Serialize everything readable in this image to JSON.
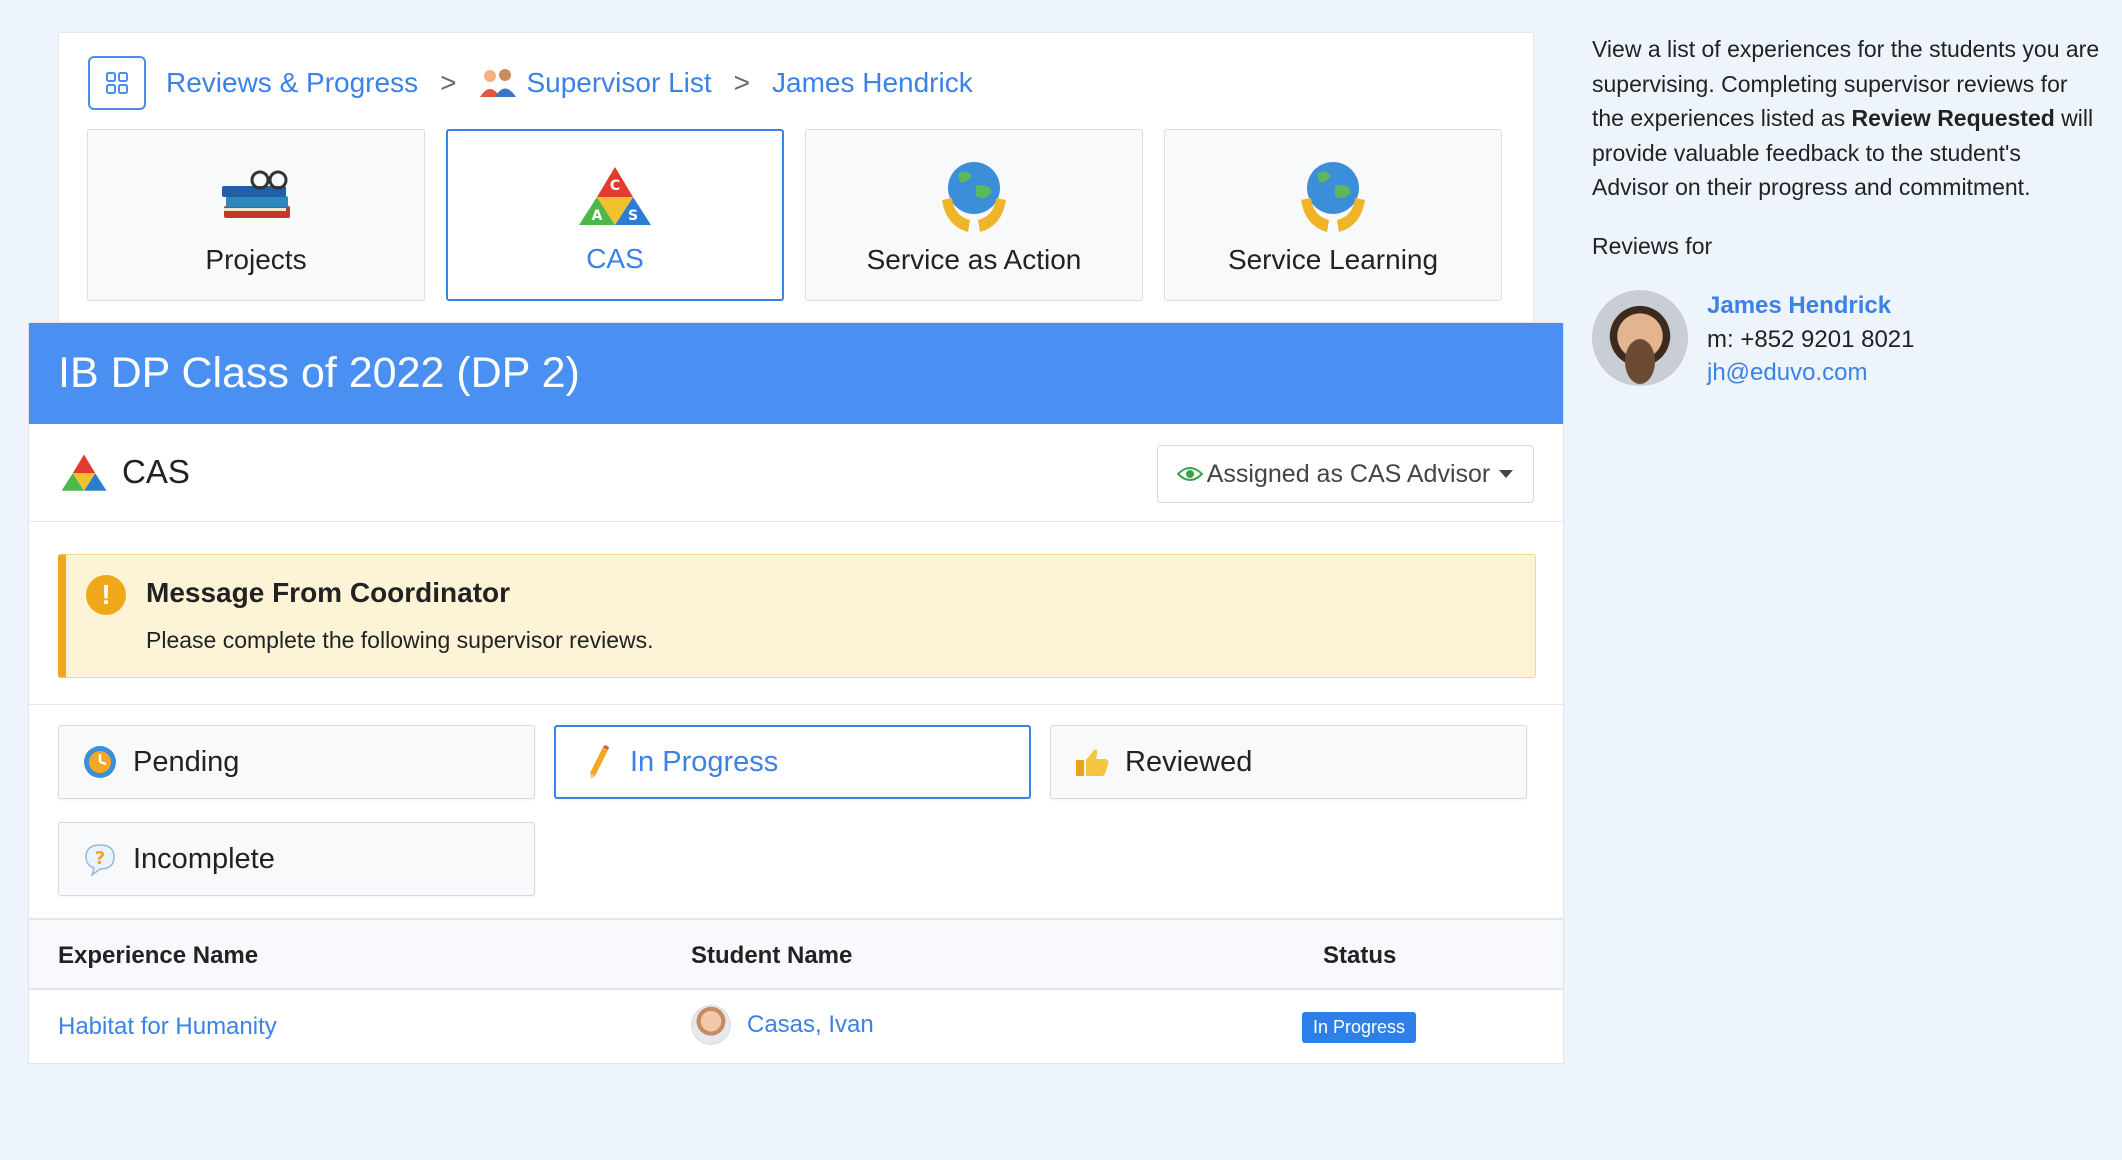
{
  "breadcrumb": {
    "items": [
      "Reviews & Progress",
      "Supervisor List",
      "James Hendrick"
    ],
    "separator": ">"
  },
  "program_tiles": [
    {
      "label": "Projects",
      "icon": "books-icon",
      "active": false
    },
    {
      "label": "CAS",
      "icon": "cas-triangle-icon",
      "active": true
    },
    {
      "label": "Service as Action",
      "icon": "globe-hands-icon",
      "active": false
    },
    {
      "label": "Service Learning",
      "icon": "globe-hands-icon",
      "active": false
    }
  ],
  "class_banner": "IB DP Class of 2022 (DP 2)",
  "section": {
    "title": "CAS",
    "assigned_dropdown": "Assigned as CAS Advisor"
  },
  "message": {
    "title": "Message From Coordinator",
    "body": "Please complete the following supervisor reviews.",
    "icon": "!"
  },
  "filters": [
    {
      "label": "Pending",
      "icon": "clock-icon",
      "active": false
    },
    {
      "label": "In Progress",
      "icon": "pencil-icon",
      "active": true
    },
    {
      "label": "Reviewed",
      "icon": "thumbs-up-icon",
      "active": false
    },
    {
      "label": "Incomplete",
      "icon": "question-bubble-icon",
      "active": false
    }
  ],
  "table": {
    "headers": [
      "Experience Name",
      "Student Name",
      "Status"
    ],
    "rows": [
      {
        "experience": "Habitat for Humanity",
        "student": "Casas, Ivan",
        "status": "In Progress"
      }
    ]
  },
  "sidebar": {
    "desc_pre": "View a list of experiences for the students you are supervising. Completing supervisor reviews for the experiences listed as ",
    "desc_bold": "Review Requested",
    "desc_post": " will provide valuable feedback to the student's Advisor on their progress and commitment.",
    "reviews_for": "Reviews for",
    "person": {
      "name": "James Hendrick",
      "phone": "m: +852 9201 8021",
      "email": "jh@eduvo.com"
    }
  },
  "colors": {
    "accent": "#3b82e6",
    "banner": "#4a90f2",
    "warning": "#f0a71a",
    "background": "#eef4fc"
  }
}
